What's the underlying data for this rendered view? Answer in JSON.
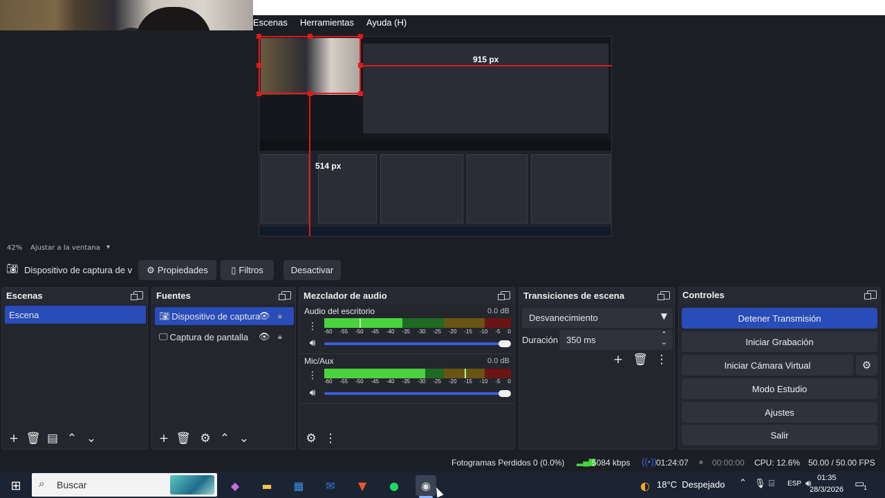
{
  "menubar": {
    "items": [
      "Escenas",
      "Herramientas",
      "Ayuda (H)"
    ]
  },
  "preview": {
    "width_label": "915 px",
    "height_label": "514 px"
  },
  "zoom": {
    "percent": "42%",
    "fit_label": "Ajustar a la ventana"
  },
  "source_toolbar": {
    "source_name": "Dispositivo de captura de v",
    "properties_label": "Propiedades",
    "filters_label": "Filtros",
    "deactivate_label": "Desactivar"
  },
  "scenes": {
    "title": "Escenas",
    "items": [
      "Escena"
    ]
  },
  "sources": {
    "title": "Fuentes",
    "items": [
      "Dispositivo de captura",
      "Captura de pantalla"
    ]
  },
  "mixer": {
    "title": "Mezclador de audio",
    "tick_labels": [
      "-60",
      "-55",
      "-50",
      "-45",
      "-40",
      "-35",
      "-30",
      "-25",
      "-20",
      "-15",
      "-10",
      "-5",
      "0"
    ],
    "channels": [
      {
        "name": "Audio del escritorio",
        "db": "0.0 dB",
        "level": 0.42,
        "peak": 0.19
      },
      {
        "name": "Mic/Aux",
        "db": "0.0 dB",
        "level": 0.54,
        "peak": 0.75
      }
    ]
  },
  "transitions": {
    "title": "Transiciones de escena",
    "selected": "Desvanecimiento",
    "duration_label": "Duración",
    "duration_value": "350 ms"
  },
  "controls": {
    "title": "Controles",
    "buttons": [
      "Detener Transmisión",
      "Iniciar Grabación",
      "Iniciar Cámara Virtual",
      "Modo Estudio",
      "Ajustes",
      "Salir"
    ]
  },
  "status": {
    "dropped_frames": "Fotogramas Perdidos 0 (0.0%)",
    "bitrate": "5084 kbps",
    "stream_time": "01:24:07",
    "rec_time": "00:00:00",
    "cpu": "CPU: 12.6%",
    "fps": "50.00 / 50.00 FPS"
  },
  "taskbar": {
    "search_placeholder": "Buscar",
    "weather": "18°C  Despejado",
    "lang": "ESP",
    "time": "01:35",
    "date": "28/3/2026",
    "notification_count": "1"
  },
  "colors": {
    "accent": "#284cb8",
    "background": "#1c1e25",
    "panel": "#24262e",
    "meter_green": "#4ad33f",
    "guide_red": "#e01919"
  }
}
